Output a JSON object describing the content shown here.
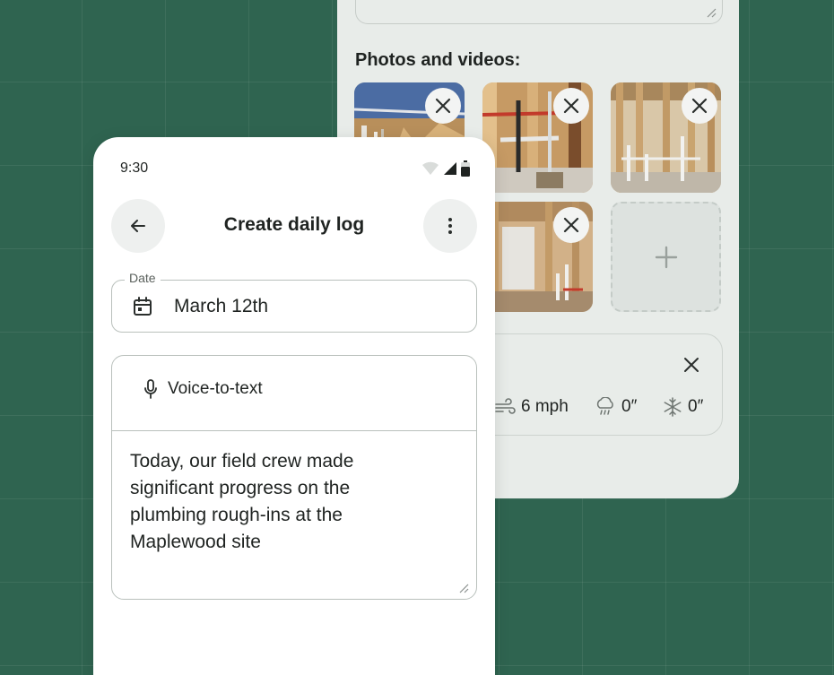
{
  "back_panel": {
    "photos_heading": "Photos and videos:",
    "add_media_icon": "plus-icon",
    "weather": {
      "wind": "6 mph",
      "rain": "0″",
      "snow": "0″"
    }
  },
  "phone": {
    "status_time": "9:30",
    "title": "Create daily log",
    "date_label": "Date",
    "date_value": "March 12th",
    "voice_label": "Voice-to-text",
    "notes_lines": [
      "Today, our field crew made",
      "significant progress on the",
      "plumbing rough-ins at the",
      "Maplewood site"
    ]
  },
  "colors": {
    "background": "#2f6450",
    "panel": "#e8ece9",
    "card": "#ffffff",
    "text": "#1f2321"
  }
}
